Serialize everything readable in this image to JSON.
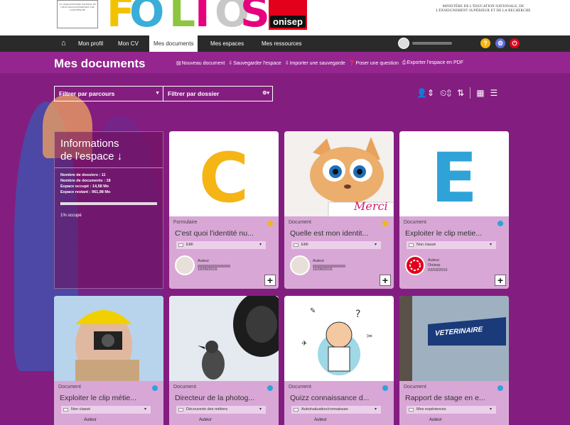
{
  "header": {
    "crest_text": "LE CINQUANTENAIRE NATIONAL DE L'EDUCATION SUPERIEURE ET DE LA RECHERCHE",
    "brand_letters": [
      "F",
      "O",
      "L",
      "I",
      "O",
      "S"
    ],
    "brand_partner": "onisep",
    "ministry_text": "MINISTÈRE DE L'ÉDUCATION NATIONALE, DE L'ENSEIGNEMENT SUPÉRIEUR ET DE LA RECHERCHE"
  },
  "nav": {
    "home_icon": "home-icon",
    "items": [
      "Mon profil",
      "Mon CV",
      "Mes documents",
      "Mes espaces",
      "Mes ressources"
    ],
    "active": "Mes documents"
  },
  "toolbar": {
    "title": "Mes documents",
    "actions": [
      {
        "icon": "new-doc-icon",
        "label": "Nouveau document"
      },
      {
        "icon": "save-icon",
        "label": "Sauvegarder l'espace"
      },
      {
        "icon": "import-icon",
        "label": "Importer une sauvegarde"
      },
      {
        "icon": "question-icon",
        "label": "Poser une question"
      },
      {
        "icon": "pdf-icon",
        "label": "Exporter l'espace en PDF"
      }
    ]
  },
  "filters": {
    "parcours": "Filtrer par parcours",
    "dossier": "Filtrer par dossier"
  },
  "info": {
    "title_line1": "Informations",
    "title_line2": "de l'espace ↓",
    "dossiers": "Nombre de dossiers : 11",
    "documents": "Nombre de documents : 18",
    "occupe": "Espace occupé : 14,58 Mo",
    "restant": "Espace restant : 961,98 Mo",
    "progress": 0.01,
    "percent_label": "1% occupé"
  },
  "cards": [
    {
      "type": "Formulaire",
      "dot": "#f5b515",
      "title": "C'est quoi l'identité nu...",
      "folder": "EMI",
      "author_label": "Auteur",
      "date": "16/06/2016",
      "author_name": ""
    },
    {
      "type": "Document",
      "dot": "#f5b515",
      "title": "Quelle est mon identit...",
      "folder": "EMI",
      "author_label": "Auteur",
      "date": "16/06/2016",
      "author_name": ""
    },
    {
      "type": "Document",
      "dot": "#2fa3d8",
      "title": "Exploiter le clip metie...",
      "folder": "Non classé",
      "author_label": "Auteur",
      "date": "03/03/2016",
      "author_name": "Onisep"
    },
    {
      "type": "Document",
      "dot": "#2fa3d8",
      "title": "Exploiter le clip métie...",
      "folder": "Non classé",
      "author_label": "Auteur"
    },
    {
      "type": "Document",
      "dot": "#2fa3d8",
      "title": "Directeur de la photog...",
      "folder": "Découverte des métiers",
      "author_label": "Auteur"
    },
    {
      "type": "Document",
      "dot": "#2fa3d8",
      "title": "Quizz connaissance d...",
      "folder": "Autoévaluation/connaissan",
      "author_label": "Auteur"
    },
    {
      "type": "Document",
      "dot": "#2fa3d8",
      "title": "Rapport de stage en e...",
      "folder": "Mes expériences",
      "author_label": "Auteur"
    }
  ],
  "thumb_texts": {
    "letter_c": "C",
    "letter_e": "E",
    "merci": "Merci",
    "veterinaire": "VETERINAIRE"
  }
}
